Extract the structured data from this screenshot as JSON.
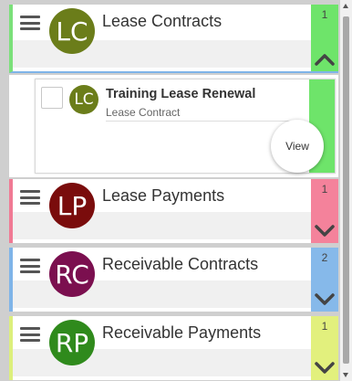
{
  "groups": [
    {
      "initials": "LC",
      "title": "Lease Contracts",
      "count": "1",
      "avatar_color": "#6b7d1a",
      "accent_color": "#7be07a",
      "side_color": "#6ee46a",
      "expanded": true
    },
    {
      "initials": "LP",
      "title": "Lease Payments",
      "count": "1",
      "avatar_color": "#7a0c0c",
      "accent_color": "#f07a94",
      "side_color": "#f4829b",
      "expanded": false
    },
    {
      "initials": "RC",
      "title": "Receivable Contracts",
      "count": "2",
      "avatar_color": "#7b0f4f",
      "accent_color": "#7fb4e8",
      "side_color": "#86b9ea",
      "expanded": false
    },
    {
      "initials": "RP",
      "title": "Receivable Payments",
      "count": "1",
      "avatar_color": "#2f8a1c",
      "accent_color": "#dcef7c",
      "side_color": "#e2f07d",
      "expanded": false
    }
  ],
  "card": {
    "initials": "LC",
    "title": "Training Lease Renewal",
    "subtitle": "Lease Contract",
    "view_label": "View"
  },
  "icons": {
    "menu": "hamburger-icon",
    "collapse": "chevron-up-icon",
    "expand": "chevron-down-icon"
  }
}
